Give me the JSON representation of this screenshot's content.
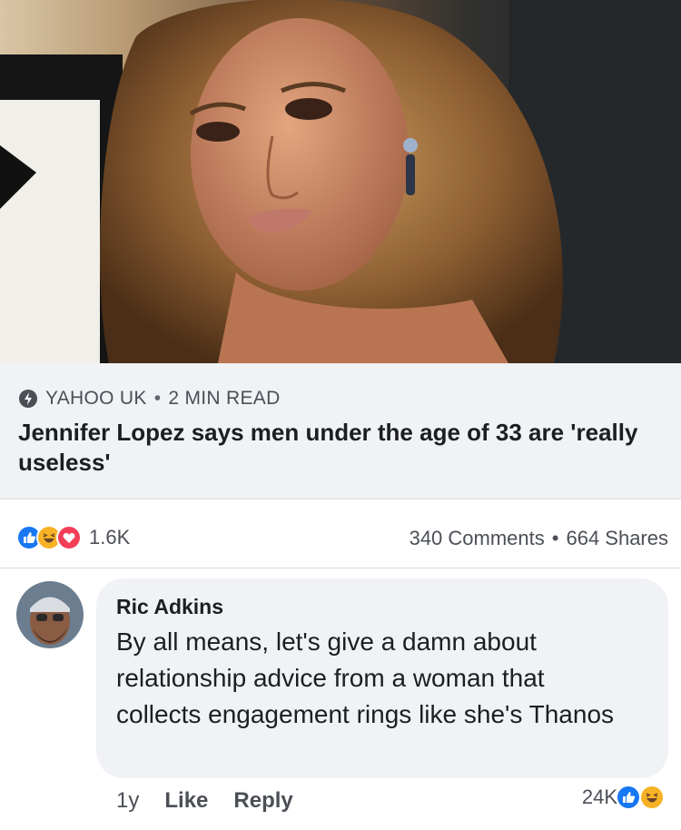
{
  "post": {
    "source": "YAHOO UK",
    "read_time": "2 MIN READ",
    "headline": "Jennifer Lopez says men under the age of 33 are 'really useless'"
  },
  "reactions": {
    "count": "1.6K",
    "comments": "340 Comments",
    "shares": "664 Shares",
    "types": [
      "like-icon",
      "haha-icon",
      "love-icon"
    ]
  },
  "comment": {
    "author": "Ric Adkins",
    "text": "By all means,  let's give a damn about relationship advice from a woman that collects engagement rings like she's Thanos",
    "age": "1y",
    "like_label": "Like",
    "reply_label": "Reply",
    "reaction_count": "24K",
    "reaction_types": [
      "like-icon",
      "haha-icon"
    ]
  },
  "colors": {
    "like_blue": "#1877f2",
    "love_red": "#f33e58",
    "haha_yellow": "#f7b125",
    "card_bg": "#f0f2f5"
  }
}
